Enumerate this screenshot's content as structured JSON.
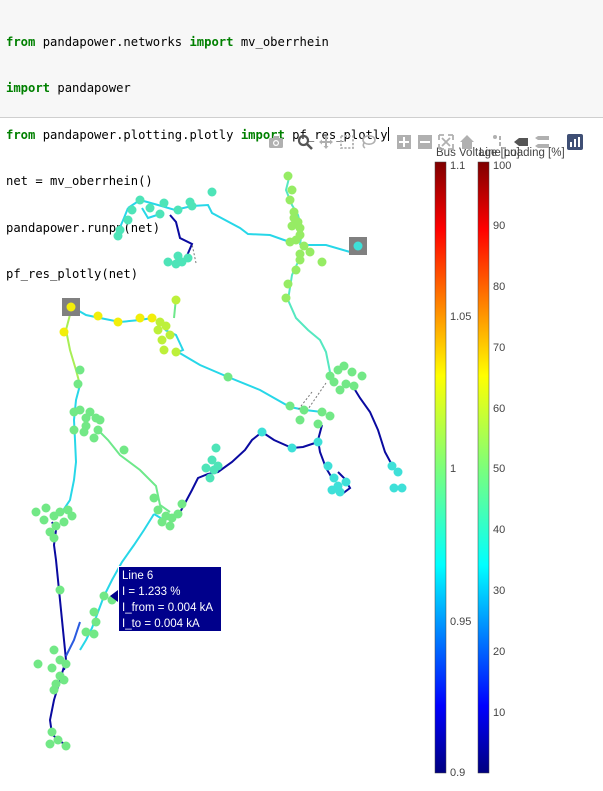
{
  "code_cell": {
    "lines": [
      {
        "kw1": "from",
        "a": " pandapower.networks ",
        "kw2": "import",
        "b": " mv_oberrhein"
      },
      {
        "kw1": "import",
        "a": " pandapower",
        "kw2": "",
        "b": ""
      },
      {
        "kw1": "from",
        "a": " pandapower.plotting.plotly ",
        "kw2": "import",
        "b": " pf_res_plotly"
      },
      {
        "kw1": "",
        "a": "net = mv_oberrhein()",
        "kw2": "",
        "b": ""
      },
      {
        "kw1": "",
        "a": "pandapower.runpp(net)",
        "kw2": "",
        "b": ""
      },
      {
        "kw1": "",
        "a": "pf_res_plotly(net)",
        "kw2": "",
        "b": ""
      }
    ]
  },
  "modebar": {
    "icons": [
      "camera-icon",
      "zoom-icon",
      "pan-icon",
      "box-select-icon",
      "lasso-icon",
      "zoom-in-icon",
      "zoom-out-icon",
      "autoscale-icon",
      "reset-axes-icon",
      "spike-lines-icon",
      "hover-closest-icon",
      "hover-compare-icon",
      "plotly-logo-icon"
    ]
  },
  "colorbars": {
    "bus": {
      "title": "Bus Voltage [pu]",
      "ticks": [
        "1.1",
        "1.05",
        "1",
        "0.95",
        "0.9"
      ]
    },
    "line": {
      "title": "Line Loading [%]",
      "ticks": [
        "100",
        "90",
        "80",
        "70",
        "60",
        "50",
        "40",
        "30",
        "20",
        "10"
      ]
    }
  },
  "hover": {
    "name": "Line 6",
    "loading": "I = 1.233 %",
    "i_from": "I_from = 0.004 kA",
    "i_to": "I_to = 0.004 kA"
  },
  "colors": {
    "code_bg": "#f7f7f7",
    "keyword": "#008000",
    "hover_bg": "#00008b",
    "ext_grid": "#808080"
  }
}
